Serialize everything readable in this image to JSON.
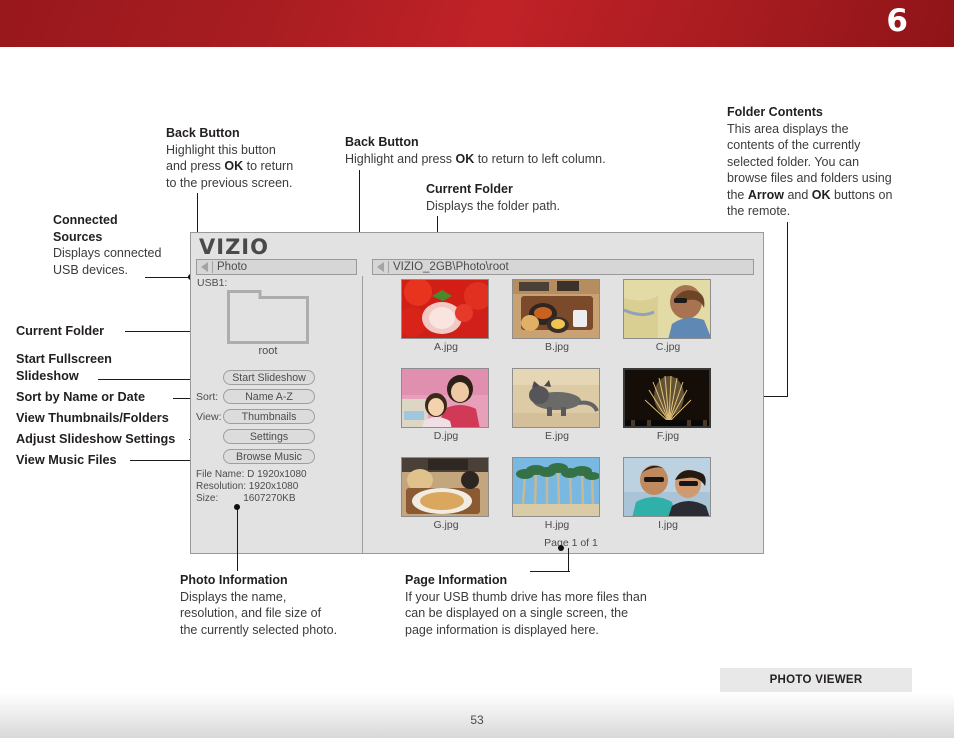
{
  "header": {
    "chapter_number": "6",
    "accent_color": "#a81d21"
  },
  "callouts": {
    "connected_sources": {
      "title": "Connected Sources",
      "body": "Displays connected USB devices."
    },
    "back_button_left": {
      "title": "Back Button",
      "body_1": "Highlight this button",
      "body_2": "and press ",
      "body_ok": "OK",
      "body_3": " to return",
      "body_4": "to the previous screen."
    },
    "back_button_center": {
      "title": "Back Button",
      "body_1": "Highlight and press ",
      "body_ok": "OK",
      "body_2": " to return to left column."
    },
    "current_folder_top": {
      "title": "Current Folder",
      "body": "Displays the folder path."
    },
    "folder_contents": {
      "title": "Folder Contents",
      "body_1": "This area displays the contents of the currently selected folder. You can browse files and folders using the ",
      "body_arrow": "Arrow",
      "body_2": " and ",
      "body_ok": "OK",
      "body_3": " buttons on the remote."
    },
    "photo_information": {
      "title": "Photo Information",
      "body": "Displays the name, resolution, and file size of the currently selected photo."
    },
    "page_information": {
      "title": "Page Information",
      "body": "If your USB thumb drive has more files than can be displayed on a single screen, the page information is displayed here."
    }
  },
  "left_labels": [
    {
      "id": "current-folder",
      "text": "Current Folder"
    },
    {
      "id": "start-fullscreen-slideshow-1",
      "text": "Start Fullscreen"
    },
    {
      "id": "start-fullscreen-slideshow-2",
      "text": "Slideshow"
    },
    {
      "id": "sort-by-name-or-date",
      "text": "Sort by Name or Date"
    },
    {
      "id": "view-thumbnails-folders",
      "text": "View Thumbnails/Folders"
    },
    {
      "id": "adjust-slideshow-settings",
      "text": "Adjust Slideshow Settings"
    },
    {
      "id": "view-music-files",
      "text": "View Music Files"
    }
  ],
  "tv_ui": {
    "brand": "VIZIO",
    "breadcrumb_left": "Photo",
    "breadcrumb_right": "VIZIO_2GB\\Photo\\root",
    "usb_label": "USB1:",
    "folder_name": "root",
    "buttons": [
      {
        "id": "start-slideshow",
        "prefix": "",
        "label": "Start Slideshow"
      },
      {
        "id": "sort",
        "prefix": "Sort:",
        "label": "Name A-Z"
      },
      {
        "id": "view",
        "prefix": "View:",
        "label": "Thumbnails"
      },
      {
        "id": "settings",
        "prefix": "",
        "label": "Settings"
      },
      {
        "id": "browse-music",
        "prefix": "",
        "label": "Browse Music"
      }
    ],
    "file_info": {
      "file_name": "File Name: D 1920x1080",
      "resolution": "Resolution: 1920x1080",
      "size": "Size:         1607270KB"
    },
    "thumbnails": [
      {
        "id": "a",
        "label": "A.jpg",
        "selected": false,
        "kind": "strawberries"
      },
      {
        "id": "b",
        "label": "B.jpg",
        "selected": false,
        "kind": "meal-tray"
      },
      {
        "id": "c",
        "label": "C.jpg",
        "selected": false,
        "kind": "woman-beach"
      },
      {
        "id": "d",
        "label": "D.jpg",
        "selected": false,
        "kind": "two-girls"
      },
      {
        "id": "e",
        "label": "E.jpg",
        "selected": false,
        "kind": "cat"
      },
      {
        "id": "f",
        "label": "F.jpg",
        "selected": true,
        "kind": "fireworks"
      },
      {
        "id": "g",
        "label": "G.jpg",
        "selected": false,
        "kind": "pasta-plate"
      },
      {
        "id": "h",
        "label": "H.jpg",
        "selected": false,
        "kind": "palm-trees"
      },
      {
        "id": "i",
        "label": "I.jpg",
        "selected": false,
        "kind": "couple-selfie"
      }
    ],
    "page_info": "Page 1 of 1"
  },
  "footer": {
    "section_tab": "PHOTO VIEWER",
    "page_number": "53"
  }
}
